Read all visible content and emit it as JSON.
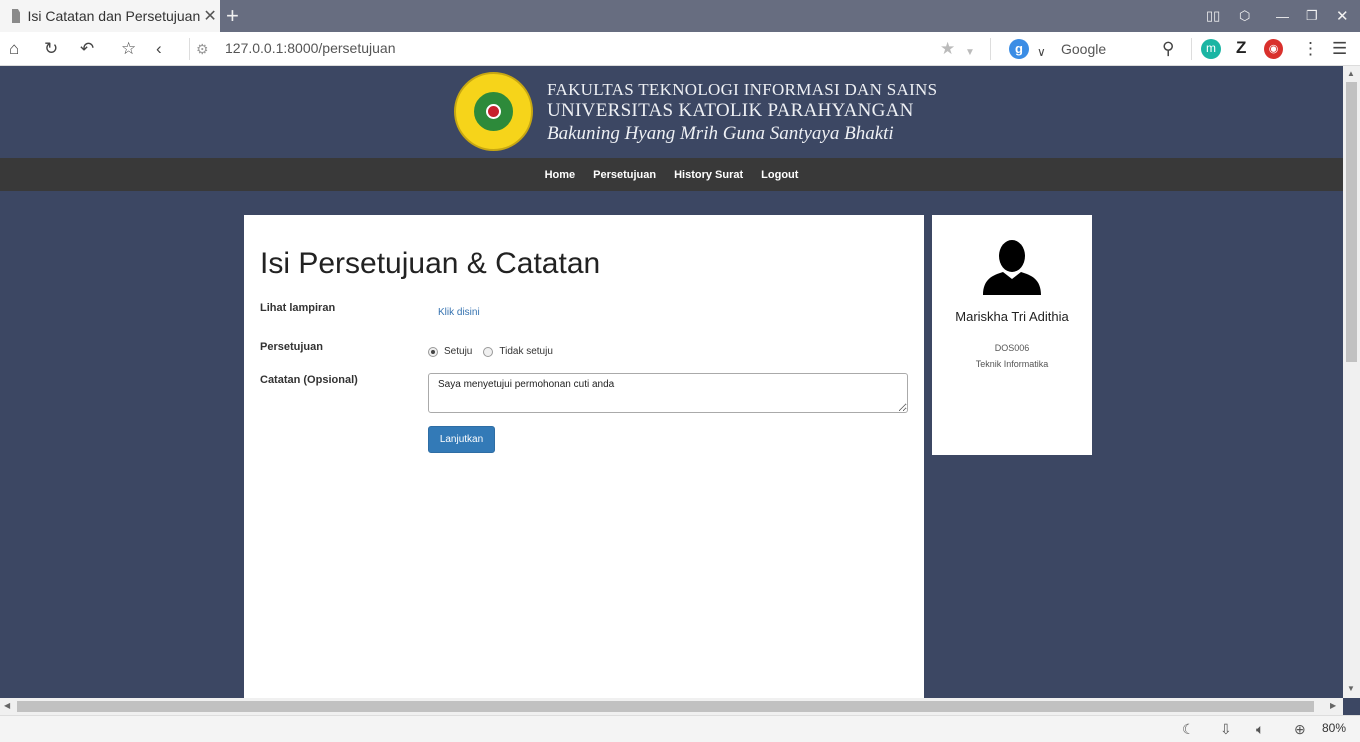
{
  "browser": {
    "tab_title": "Isi Catatan dan Persetujuan",
    "url": "127.0.0.1:8000/persetujuan",
    "search_placeholder": "Google",
    "zoom": "80%"
  },
  "header": {
    "faculty": "FAKULTAS TEKNOLOGI INFORMASI DAN SAINS",
    "university": "UNIVERSITAS KATOLIK PARAHYANGAN",
    "motto": "Bakuning Hyang Mrih Guna Santyaya Bhakti"
  },
  "nav": {
    "items": [
      {
        "label": "Home"
      },
      {
        "label": "Persetujuan"
      },
      {
        "label": "History Surat"
      },
      {
        "label": "Logout"
      }
    ]
  },
  "form": {
    "title": "Isi Persetujuan & Catatan",
    "attachment_label": "Lihat lampiran",
    "attachment_link": "Klik disini",
    "approval_label": "Persetujuan",
    "options": [
      {
        "label": "Setuju",
        "checked": true
      },
      {
        "label": "Tidak setuju",
        "checked": false
      }
    ],
    "notes_label": "Catatan (Opsional)",
    "notes_value": "Saya menyetujui permohonan cuti anda",
    "submit_label": "Lanjutkan"
  },
  "profile": {
    "name": "Mariskha Tri Adithia",
    "id": "DOS006",
    "department": "Teknik Informatika"
  }
}
